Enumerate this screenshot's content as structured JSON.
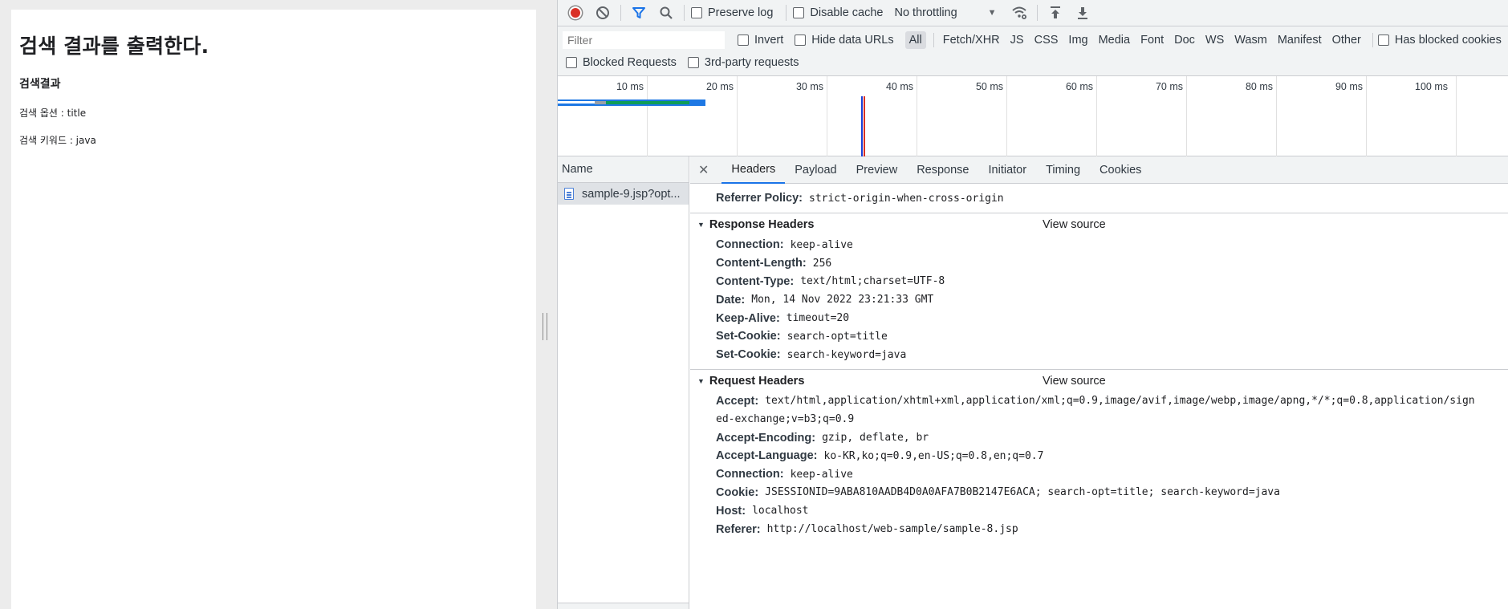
{
  "page": {
    "heading": "검색 결과를 출력한다.",
    "subheading": "검색결과",
    "lines": [
      "검색 옵션 : title",
      "검색 키워드 : java"
    ]
  },
  "toolbar": {
    "preserve_log": "Preserve log",
    "disable_cache": "Disable cache",
    "throttling": "No throttling"
  },
  "filter": {
    "placeholder": "Filter",
    "invert": "Invert",
    "hide_data_urls": "Hide data URLs",
    "types": [
      "All",
      "Fetch/XHR",
      "JS",
      "CSS",
      "Img",
      "Media",
      "Font",
      "Doc",
      "WS",
      "Wasm",
      "Manifest",
      "Other"
    ],
    "has_blocked_cookies": "Has blocked cookies",
    "blocked_requests": "Blocked Requests",
    "third_party": "3rd-party requests"
  },
  "timeline": {
    "ticks": [
      "10 ms",
      "20 ms",
      "30 ms",
      "40 ms",
      "50 ms",
      "60 ms",
      "70 ms",
      "80 ms",
      "90 ms",
      "100 ms"
    ]
  },
  "request_list": {
    "header": "Name",
    "item": "sample-9.jsp?opt..."
  },
  "details": {
    "tabs": [
      "Headers",
      "Payload",
      "Preview",
      "Response",
      "Initiator",
      "Timing",
      "Cookies"
    ],
    "referrer_policy": {
      "name": "Referrer Policy:",
      "value": "strict-origin-when-cross-origin"
    },
    "view_source": "View source",
    "response_title": "Response Headers",
    "response_headers": [
      {
        "name": "Connection:",
        "value": "keep-alive"
      },
      {
        "name": "Content-Length:",
        "value": "256"
      },
      {
        "name": "Content-Type:",
        "value": "text/html;charset=UTF-8"
      },
      {
        "name": "Date:",
        "value": "Mon, 14 Nov 2022 23:21:33 GMT"
      },
      {
        "name": "Keep-Alive:",
        "value": "timeout=20"
      },
      {
        "name": "Set-Cookie:",
        "value": "search-opt=title"
      },
      {
        "name": "Set-Cookie:",
        "value": "search-keyword=java"
      }
    ],
    "request_title": "Request Headers",
    "accept": {
      "name": "Accept:",
      "value": "text/html,application/xhtml+xml,application/xml;q=0.9,image/avif,image/webp,image/apng,*/*;q=0.8,application/sign",
      "cont": "ed-exchange;v=b3;q=0.9"
    },
    "request_headers": [
      {
        "name": "Accept-Encoding:",
        "value": "gzip, deflate, br"
      },
      {
        "name": "Accept-Language:",
        "value": "ko-KR,ko;q=0.9,en-US;q=0.8,en;q=0.7"
      },
      {
        "name": "Connection:",
        "value": "keep-alive"
      },
      {
        "name": "Cookie:",
        "value": "JSESSIONID=9ABA810AADB4D0A0AFA7B0B2147E6ACA; search-opt=title; search-keyword=java"
      },
      {
        "name": "Host:",
        "value": "localhost"
      },
      {
        "name": "Referer:",
        "value": "http://localhost/web-sample/sample-8.jsp"
      }
    ]
  }
}
